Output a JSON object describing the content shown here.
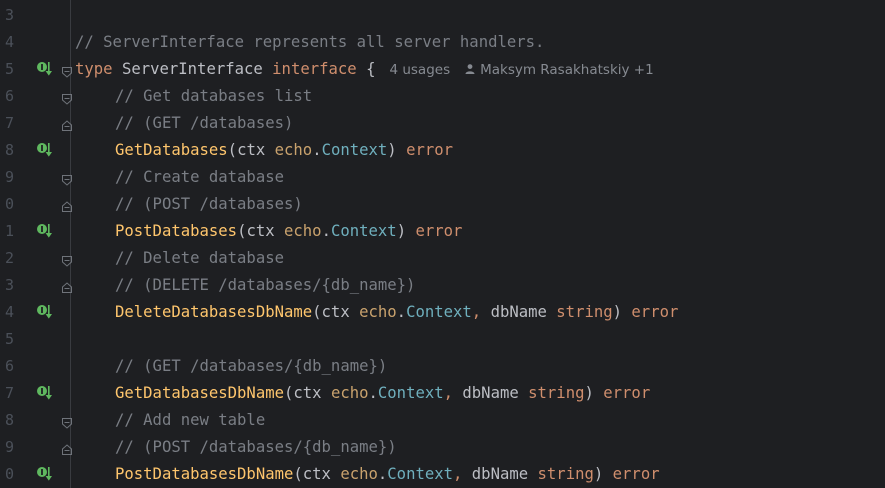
{
  "line_numbers": [
    "3",
    "4",
    "5",
    "6",
    "7",
    "8",
    "9",
    "0",
    "1",
    "2",
    "3",
    "4",
    "5",
    "6",
    "7",
    "8",
    "9",
    "0"
  ],
  "code": {
    "l4": {
      "comment": "// ServerInterface represents all server handlers."
    },
    "l5": {
      "kw_type": "type",
      "name": "ServerInterface",
      "kw_interface": "interface",
      "brace": "{",
      "usages": "4 usages",
      "author": "Maksym Rasakhatskiy +1"
    },
    "l6": {
      "comment": "// Get databases list"
    },
    "l7": {
      "comment": "// (GET /databases)"
    },
    "l8": {
      "method": "GetDatabases",
      "open": "(",
      "param": "ctx",
      "pkg": "echo",
      "dot": ".",
      "type": "Context",
      "close": ")",
      "ret": "error"
    },
    "l9": {
      "comment": "// Create database"
    },
    "l10": {
      "comment": "// (POST /databases)"
    },
    "l11": {
      "method": "PostDatabases",
      "open": "(",
      "param": "ctx",
      "pkg": "echo",
      "dot": ".",
      "type": "Context",
      "close": ")",
      "ret": "error"
    },
    "l12": {
      "comment": "// Delete database"
    },
    "l13": {
      "comment": "// (DELETE /databases/{db_name})"
    },
    "l14": {
      "method": "DeleteDatabasesDbName",
      "open": "(",
      "param": "ctx",
      "pkg": "echo",
      "dot": ".",
      "type": "Context",
      "comma": ",",
      "param2": "dbName",
      "type2": "string",
      "close": ")",
      "ret": "error"
    },
    "l16": {
      "comment": "// (GET /databases/{db_name})"
    },
    "l17": {
      "method": "GetDatabasesDbName",
      "open": "(",
      "param": "ctx",
      "pkg": "echo",
      "dot": ".",
      "type": "Context",
      "comma": ",",
      "param2": "dbName",
      "type2": "string",
      "close": ")",
      "ret": "error"
    },
    "l18": {
      "comment": "// Add new table"
    },
    "l19": {
      "comment": "// (POST /databases/{db_name})"
    },
    "l20": {
      "method": "PostDatabasesDbName",
      "open": "(",
      "param": "ctx",
      "pkg": "echo",
      "dot": ".",
      "type": "Context",
      "comma": ",",
      "param2": "dbName",
      "type2": "string",
      "close": ")",
      "ret": "error"
    }
  },
  "colors": {
    "background": "#1e1f22",
    "comment": "#7a7e85",
    "keyword": "#cf8e6d",
    "method": "#56a8f5",
    "type_name": "#bcbec4",
    "implemented_icon": "#5fb85f"
  },
  "icons": {
    "implemented": "implemented-icon",
    "fold": "fold-icon",
    "author": "user-icon"
  }
}
